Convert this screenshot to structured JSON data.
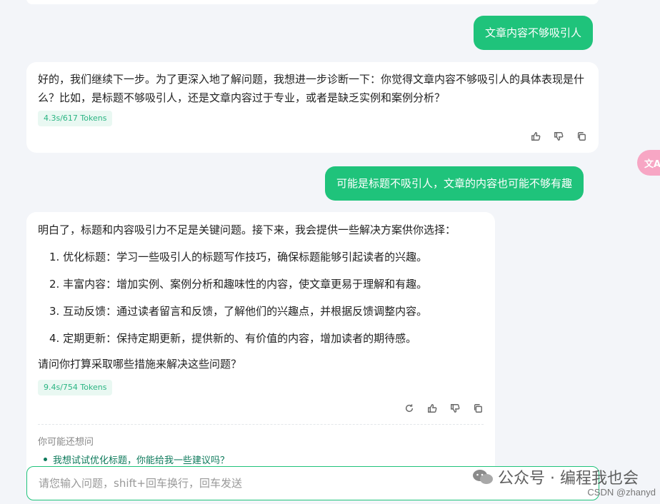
{
  "messages": {
    "user1": "文章内容不够吸引人",
    "bot1": {
      "text": "好的，我们继续下一步。为了更深入地了解问题，我想进一步诊断一下：你觉得文章内容不够吸引人的具体表现是什么？比如，是标题不够吸引人，还是文章内容过于专业，或者是缺乏实例和案例分析？",
      "tokens": "4.3s/617 Tokens"
    },
    "user2": "可能是标题不吸引人，文章的内容也可能不够有趣",
    "bot2": {
      "intro": "明白了，标题和内容吸引力不足是关键问题。接下来，我会提供一些解决方案供你选择：",
      "items": [
        "1. 优化标题：学习一些吸引人的标题写作技巧，确保标题能够引起读者的兴趣。",
        "2. 丰富内容：增加实例、案例分析和趣味性的内容，使文章更易于理解和有趣。",
        "3. 互动反馈：通过读者留言和反馈，了解他们的兴趣点，并根据反馈调整内容。",
        "4. 定期更新：保持定期更新，提供新的、有价值的内容，增加读者的期待感。"
      ],
      "question": "请问你打算采取哪些措施来解决这些问题？",
      "tokens": "9.4s/754 Tokens"
    }
  },
  "suggestions": {
    "title": "你可能还想问",
    "items": [
      "我想试试优化标题，你能给我一些建议吗？"
    ]
  },
  "input": {
    "placeholder": "请您输入问题，shift+回车换行，回车发送"
  },
  "translate_label": "文A",
  "watermark": {
    "text": "公众号 · 编程我也会",
    "csdn": "CSDN @zhanyd"
  },
  "icons": {
    "like": "thumbs-up-icon",
    "dislike": "thumbs-down-icon",
    "copy": "copy-icon",
    "regenerate": "refresh-icon"
  },
  "colors": {
    "accent": "#1fc37b",
    "background": "#f3f5f9"
  }
}
